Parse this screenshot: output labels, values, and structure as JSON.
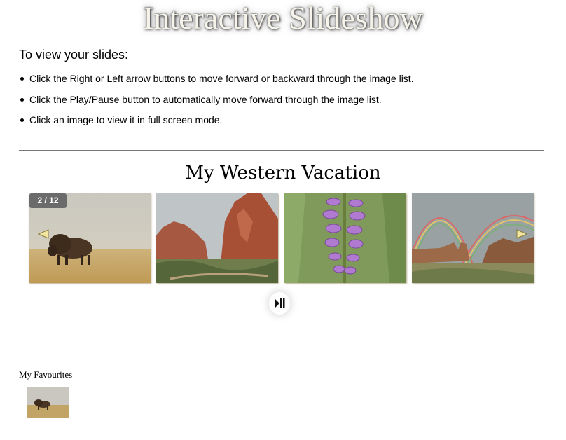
{
  "page": {
    "title": "Interactive Slideshow"
  },
  "instructions": {
    "heading": "To view your slides:",
    "items": [
      "Click the Right or Left arrow buttons to move forward or backward through the image list.",
      "Click the Play/Pause button to automatically move forward through the image list.",
      "Click an image to view it in full screen mode."
    ]
  },
  "slideshow": {
    "album_title": "My Western Vacation",
    "counter": "2 / 12",
    "current_index": 2,
    "total": 12,
    "slides": [
      {
        "subject": "bison on prairie"
      },
      {
        "subject": "red rock formations"
      },
      {
        "subject": "purple wildflower"
      },
      {
        "subject": "rainbow over canyon"
      }
    ],
    "prev_icon": "arrow-left-icon",
    "next_icon": "arrow-right-icon",
    "play_pause_icon": "play-pause-icon",
    "arrow_color": "#f2e6a0"
  },
  "favourites": {
    "heading": "My Favourites",
    "items": [
      {
        "subject": "bison on prairie"
      }
    ]
  }
}
